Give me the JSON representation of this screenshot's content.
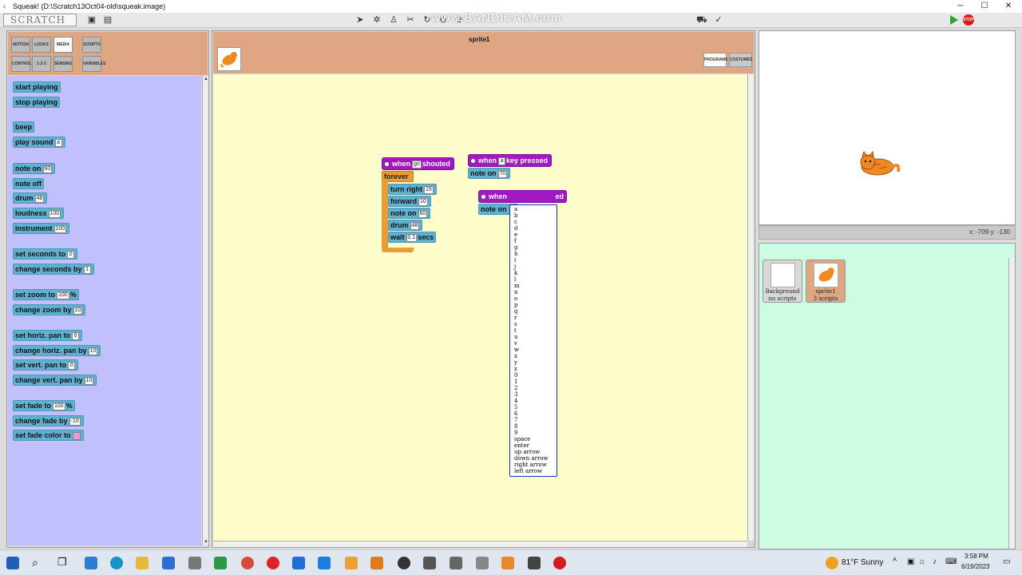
{
  "window": {
    "title": "Squeak! (D:\\Scratch13Oct04-old\\squeak.image)",
    "minimize_label": "─",
    "maximize_label": "☐",
    "close_label": "✕"
  },
  "toolbar": {
    "logo_text": "SCRATCH",
    "watermark": "www.BANDICAM.com",
    "stop_label": "STOP"
  },
  "categories": [
    {
      "label": "MOTION",
      "active": false
    },
    {
      "label": "LOOKS",
      "active": false
    },
    {
      "label": "MEDIA",
      "active": true
    },
    {
      "label": "SCRIPTS",
      "active": false
    },
    {
      "label": "CONTROL",
      "active": false
    },
    {
      "label": "1-2-3",
      "active": false
    },
    {
      "label": "SENSING",
      "active": false
    },
    {
      "label": "VARIABLES",
      "active": false
    }
  ],
  "palette": {
    "start_playing": "start playing",
    "stop_playing": "stop playing",
    "beep": "beep",
    "play_sound": "play sound",
    "play_sound_arg": "a",
    "note_on": "note on",
    "note_on_arg": "60",
    "note_off": "note off",
    "drum": "drum",
    "drum_arg": "48",
    "loudness": "loudness",
    "loudness_arg": "100",
    "instrument": "instrument",
    "instrument_arg": "100",
    "set_seconds": "set seconds to",
    "set_seconds_arg": "0",
    "change_seconds": "change seconds by",
    "change_seconds_arg": "1",
    "set_zoom": "set zoom to",
    "set_zoom_arg": "100",
    "set_zoom_unit": "%",
    "change_zoom": "change zoom by",
    "change_zoom_arg": "10",
    "set_hpan": "set horiz. pan to",
    "set_hpan_arg": "0",
    "change_hpan": "change horiz. pan by",
    "change_hpan_arg": "10",
    "set_vpan": "set vert. pan to",
    "set_vpan_arg": "0",
    "change_vpan": "change vert. pan by",
    "change_vpan_arg": "10",
    "set_fade": "set fade to",
    "set_fade_arg": "100",
    "set_fade_unit": "%",
    "change_fade": "change fade by",
    "change_fade_arg": "-10",
    "set_fade_color": "set fade color to",
    "fade_color": "#e69ad8"
  },
  "script_editor": {
    "sprite_name": "sprite1",
    "tab_programs": "PROGRAMS",
    "tab_costumes": "COSTUMES"
  },
  "scripts": {
    "s1_when": "when",
    "s1_arg": "go",
    "s1_shouted": "shouted",
    "forever": "forever",
    "turn_right": "turn right",
    "turn_right_arg": "15",
    "forward": "forward",
    "forward_arg": "10",
    "note_on": "note on",
    "note_on_arg": "60",
    "drum": "drum",
    "drum_arg": "48",
    "wait": "wait",
    "wait_arg": "0.1",
    "wait_unit": "secs",
    "s2_when": "when",
    "s2_key": "a",
    "s2_pressed": "key pressed",
    "s2_note_on": "note on",
    "s2_note_on_arg": "70",
    "s3_when": "when",
    "s3_tail": "ed",
    "s3_note_on": "note on"
  },
  "key_menu": [
    "a",
    "b",
    "c",
    "d",
    "e",
    "f",
    "g",
    "h",
    "i",
    "j",
    "k",
    "l",
    "m",
    "n",
    "o",
    "p",
    "q",
    "r",
    "s",
    "t",
    "u",
    "v",
    "w",
    "x",
    "y",
    "z",
    "0",
    "1",
    "2",
    "3",
    "4",
    "5",
    "6",
    "7",
    "8",
    "9",
    "space",
    "enter",
    "up arrow",
    "down arrow",
    "right arrow",
    "left arrow"
  ],
  "stage": {
    "coords": "x: -709  y: -130"
  },
  "sprites": [
    {
      "name": "Background",
      "scripts": "no scripts"
    },
    {
      "name": "sprite1",
      "scripts": "3 scripts"
    }
  ],
  "taskbar": {
    "weather": "81°F  Sunny",
    "time": "3:58 PM",
    "date": "6/19/2023",
    "search_icon": "search-icon",
    "start_icon": "windows-start-icon"
  },
  "colors": {
    "palette_bg": "#c0c0fc",
    "script_bg": "#fdfdcb",
    "sprite_pane_bg": "#ccfde3",
    "header_bg": "#dfa684",
    "motion_block": "#5fb1d1",
    "hat_block": "#a218c4",
    "control_block": "#eb9c34"
  }
}
